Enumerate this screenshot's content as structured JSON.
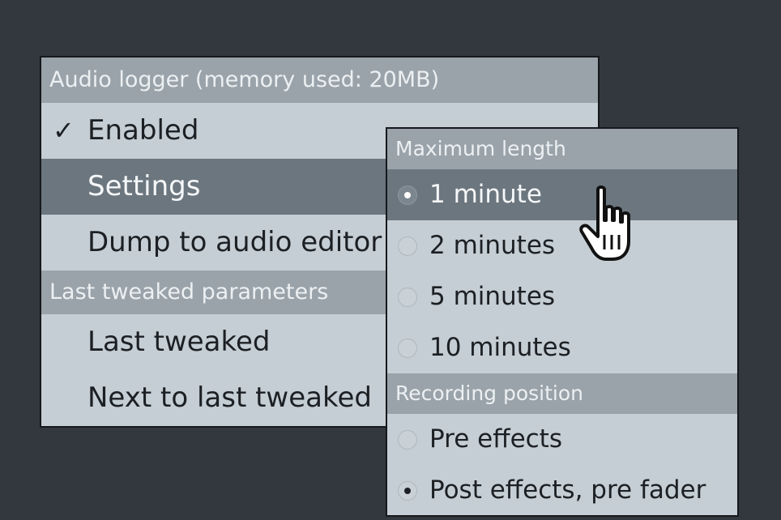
{
  "main_menu": {
    "header": "Audio logger (memory used: 20MB)",
    "items": [
      {
        "label": "Enabled",
        "check": "✓"
      },
      {
        "label": "Settings"
      },
      {
        "label": "Dump to audio editor"
      }
    ],
    "section2_header": "Last tweaked parameters",
    "section2_items": [
      {
        "label": "Last tweaked"
      },
      {
        "label": "Next to last tweaked"
      }
    ]
  },
  "sub_menu": {
    "length_header": "Maximum length",
    "length_options": [
      {
        "label": "1 minute",
        "selected": true
      },
      {
        "label": "2 minutes",
        "selected": false
      },
      {
        "label": "5 minutes",
        "selected": false
      },
      {
        "label": "10 minutes",
        "selected": false
      }
    ],
    "position_header": "Recording position",
    "position_options": [
      {
        "label": "Pre effects",
        "selected": false
      },
      {
        "label": "Post effects, pre fader",
        "selected": true
      }
    ]
  },
  "cursor": {
    "icon": "hand-pointer-icon"
  },
  "colors": {
    "background": "#33383e",
    "menu_bg": "#c5ced4",
    "header_bg": "#9aa3aa",
    "highlight_bg": "#6c767f"
  }
}
